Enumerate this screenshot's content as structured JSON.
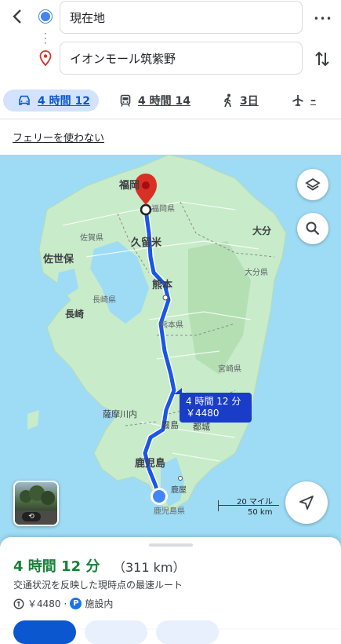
{
  "header": {
    "origin_value": "現在地",
    "destination_value": "イオンモール筑紫野",
    "more_glyph": "•••"
  },
  "modes": [
    {
      "name": "car",
      "label": "4 時間 12"
    },
    {
      "name": "transit",
      "label": "4 時間 14"
    },
    {
      "name": "walk",
      "label": "3日"
    },
    {
      "name": "flight",
      "label": "–"
    }
  ],
  "options": {
    "ferry_label": "フェリーを使わない"
  },
  "map": {
    "labels": {
      "fukuoka": "福岡",
      "fukuoka_pref": "福岡県",
      "saga_pref": "佐賀県",
      "kurume": "久留米",
      "sasebo": "佐世保",
      "oita": "大分",
      "oita_pref": "大分県",
      "kumamoto": "熊本",
      "nagasaki_pref": "長崎県",
      "nagasaki": "長崎",
      "kumamoto_pref": "熊本県",
      "miyazaki_pref": "宮崎県",
      "satsumasendai": "薩摩川内",
      "kirishima": "霧島",
      "miyakonojo": "都城",
      "kagoshima": "鹿児島",
      "kanoya": "鹿屋",
      "kagoshima_pref": "鹿児島県"
    },
    "callout_time": "4 時間 12 分",
    "callout_fare": "￥4480",
    "scale_miles": "20 マイル",
    "scale_km": "50 km",
    "colors": {
      "route": "#1a56e8",
      "water": "#9edcf5",
      "land": "#c8ebc9",
      "pin": "#d93025"
    }
  },
  "summary": {
    "duration": "4 時間 12 分",
    "distance": "（311 km）",
    "description": "交通状況を反映した現時点の最速ルート",
    "toll_fee": "￥4480",
    "separator": "·",
    "parking_badge": "P",
    "parking_text": "施設内"
  }
}
